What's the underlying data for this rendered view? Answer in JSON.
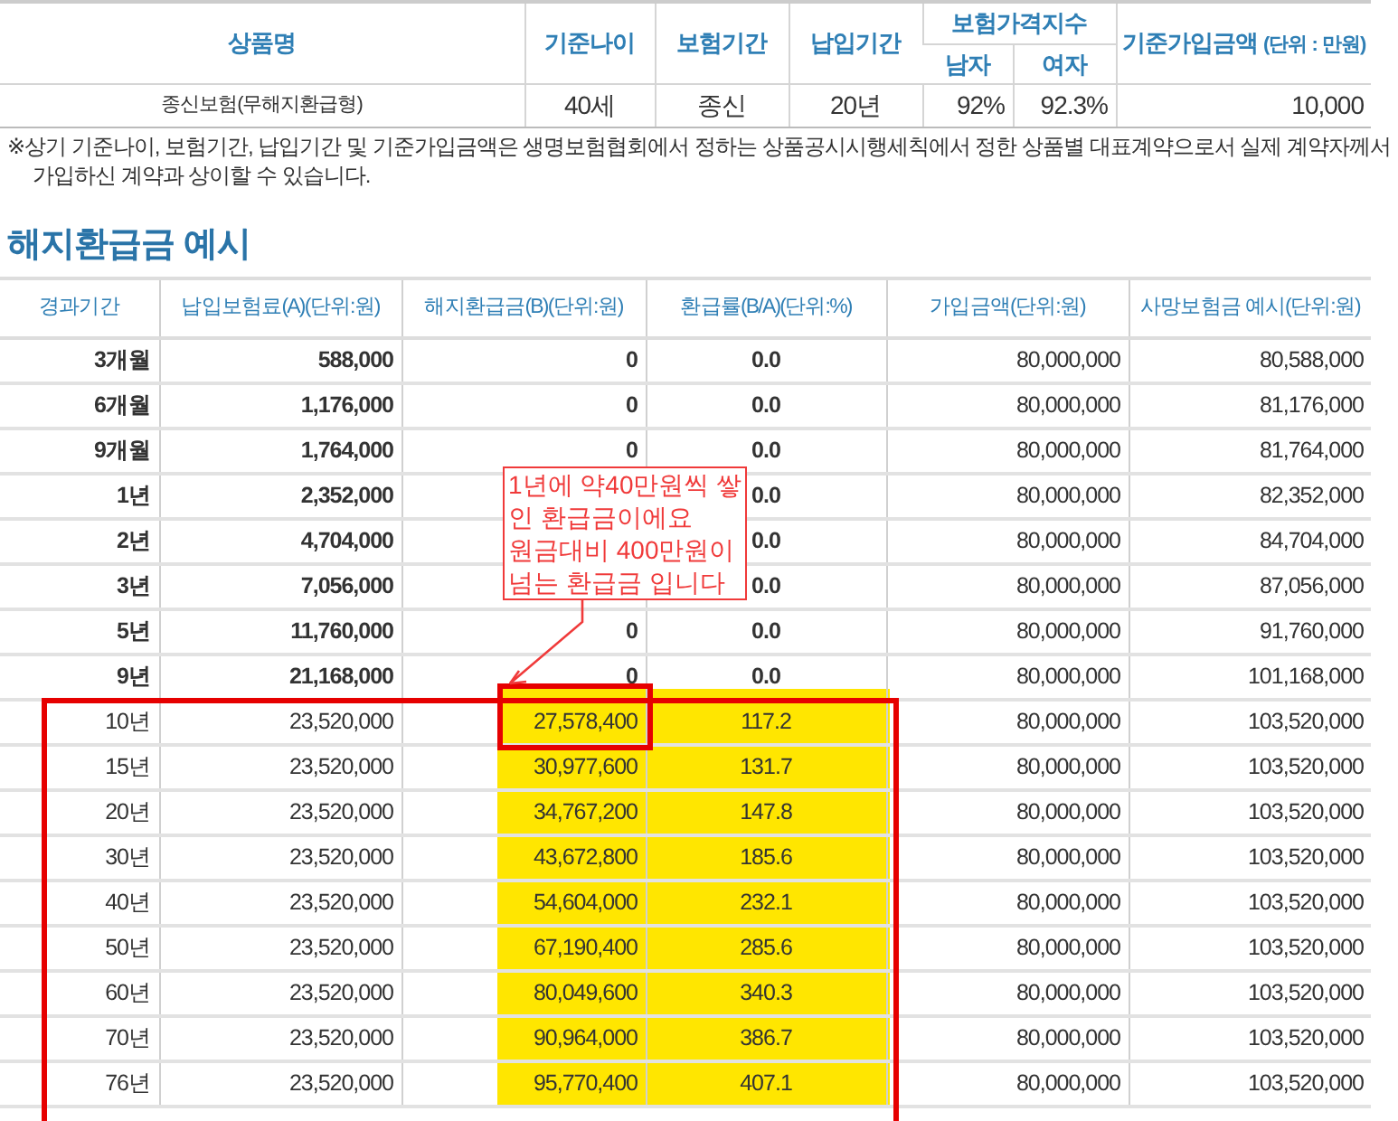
{
  "product_table": {
    "columns": {
      "product": "상품명",
      "age": "기준나이",
      "term": "보험기간",
      "pay_term": "납입기간",
      "price_index": "보험가격지수",
      "male": "남자",
      "female": "여자",
      "amount": "기준가입금액",
      "amount_unit": "(단위 : 만원)"
    },
    "row": {
      "product": "종신보험(무해지환급형)",
      "age": "40세",
      "term": "종신",
      "pay_term": "20년",
      "male": "92%",
      "female": "92.3%",
      "amount": "10,000"
    }
  },
  "note": [
    "※상기 기준나이, 보험기간, 납입기간 및 기준가입금액은 생명보험협회에서 정하는 상품공시시행세칙에서 정한 상품별 대표계약으로서 실제 계약자께서",
    "가입하신 계약과 상이할 수 있습니다."
  ],
  "section_title": "해지환급금 예시",
  "refund_table": {
    "columns": [
      "경과기간",
      "납입보험료(A)(단위:원)",
      "해지환급금(B)(단위:원)",
      "환급률(B/A)(단위:%)",
      "가입금액(단위:원)",
      "사망보험금 예시(단위:원)"
    ],
    "rows": [
      {
        "period": "3개월",
        "premium": "588,000",
        "refund": "0",
        "rate": "0.0",
        "amount": "80,000,000",
        "death": "80,588,000",
        "emphasized": true,
        "highlighted": false
      },
      {
        "period": "6개월",
        "premium": "1,176,000",
        "refund": "0",
        "rate": "0.0",
        "amount": "80,000,000",
        "death": "81,176,000",
        "emphasized": true,
        "highlighted": false
      },
      {
        "period": "9개월",
        "premium": "1,764,000",
        "refund": "0",
        "rate": "0.0",
        "amount": "80,000,000",
        "death": "81,764,000",
        "emphasized": true,
        "highlighted": false
      },
      {
        "period": "1년",
        "premium": "2,352,000",
        "rate": "0.0",
        "amount": "80,000,000",
        "death": "82,352,000",
        "emphasized": true,
        "highlighted": false
      },
      {
        "period": "2년",
        "premium": "4,704,000",
        "rate": "0.0",
        "amount": "80,000,000",
        "death": "84,704,000",
        "emphasized": true,
        "highlighted": false
      },
      {
        "period": "3년",
        "premium": "7,056,000",
        "rate": "0.0",
        "amount": "80,000,000",
        "death": "87,056,000",
        "emphasized": true,
        "highlighted": false
      },
      {
        "period": "5년",
        "premium": "11,760,000",
        "refund": "0",
        "rate": "0.0",
        "amount": "80,000,000",
        "death": "91,760,000",
        "emphasized": true,
        "highlighted": false
      },
      {
        "period": "9년",
        "premium": "21,168,000",
        "refund": "0",
        "rate": "0.0",
        "amount": "80,000,000",
        "death": "101,168,000",
        "emphasized": true,
        "highlighted": false
      },
      {
        "period": "10년",
        "premium": "23,520,000",
        "refund": "27,578,400",
        "rate": "117.2",
        "amount": "80,000,000",
        "death": "103,520,000",
        "emphasized": false,
        "highlighted": true
      },
      {
        "period": "15년",
        "premium": "23,520,000",
        "refund": "30,977,600",
        "rate": "131.7",
        "amount": "80,000,000",
        "death": "103,520,000",
        "emphasized": false,
        "highlighted": true
      },
      {
        "period": "20년",
        "premium": "23,520,000",
        "refund": "34,767,200",
        "rate": "147.8",
        "amount": "80,000,000",
        "death": "103,520,000",
        "emphasized": false,
        "highlighted": true
      },
      {
        "period": "30년",
        "premium": "23,520,000",
        "refund": "43,672,800",
        "rate": "185.6",
        "amount": "80,000,000",
        "death": "103,520,000",
        "emphasized": false,
        "highlighted": true
      },
      {
        "period": "40년",
        "premium": "23,520,000",
        "refund": "54,604,000",
        "rate": "232.1",
        "amount": "80,000,000",
        "death": "103,520,000",
        "emphasized": false,
        "highlighted": true
      },
      {
        "period": "50년",
        "premium": "23,520,000",
        "refund": "67,190,400",
        "rate": "285.6",
        "amount": "80,000,000",
        "death": "103,520,000",
        "emphasized": false,
        "highlighted": true
      },
      {
        "period": "60년",
        "premium": "23,520,000",
        "refund": "80,049,600",
        "rate": "340.3",
        "amount": "80,000,000",
        "death": "103,520,000",
        "emphasized": false,
        "highlighted": true
      },
      {
        "period": "70년",
        "premium": "23,520,000",
        "refund": "90,964,000",
        "rate": "386.7",
        "amount": "80,000,000",
        "death": "103,520,000",
        "emphasized": false,
        "highlighted": true
      },
      {
        "period": "76년",
        "premium": "23,520,000",
        "refund": "95,770,400",
        "rate": "407.1",
        "amount": "80,000,000",
        "death": "103,520,000",
        "emphasized": false,
        "highlighted": true
      }
    ]
  },
  "annotation": {
    "lines": [
      "1년에 약40만원씩 쌓",
      "인 환급금이에요",
      "원금대비 400만원이",
      "넘는 환급금 입니다"
    ]
  }
}
